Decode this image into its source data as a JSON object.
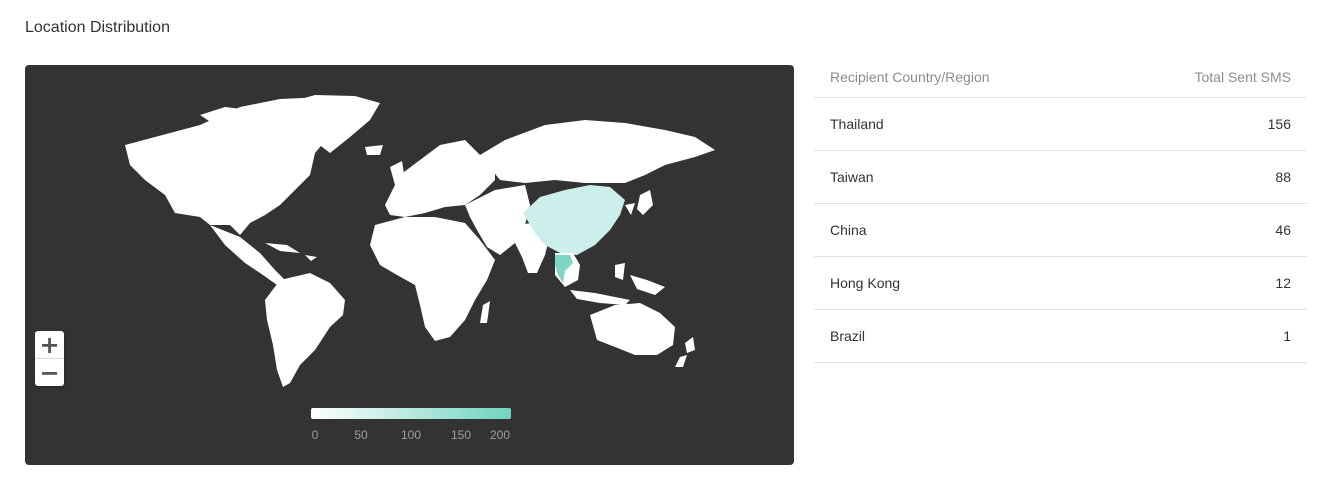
{
  "page": {
    "title": "Location Distribution"
  },
  "map": {
    "background_color": "#333333",
    "land_color": "#ffffff",
    "zoom_in_label": "+",
    "zoom_out_label": "−",
    "highlighted": [
      {
        "country": "China",
        "value": 46,
        "color": "#cdefeb"
      },
      {
        "country": "Thailand",
        "value": 156,
        "color": "#7fd6c4"
      }
    ],
    "legend": {
      "min_color": "#ffffff",
      "max_color": "#6fd4bf",
      "ticks": [
        "0",
        "50",
        "100",
        "150",
        "200"
      ]
    }
  },
  "table": {
    "headers": {
      "country": "Recipient Country/Region",
      "total": "Total Sent SMS"
    },
    "rows": [
      {
        "country": "Thailand",
        "total": "156"
      },
      {
        "country": "Taiwan",
        "total": "88"
      },
      {
        "country": "China",
        "total": "46"
      },
      {
        "country": "Hong Kong",
        "total": "12"
      },
      {
        "country": "Brazil",
        "total": "1"
      }
    ]
  }
}
